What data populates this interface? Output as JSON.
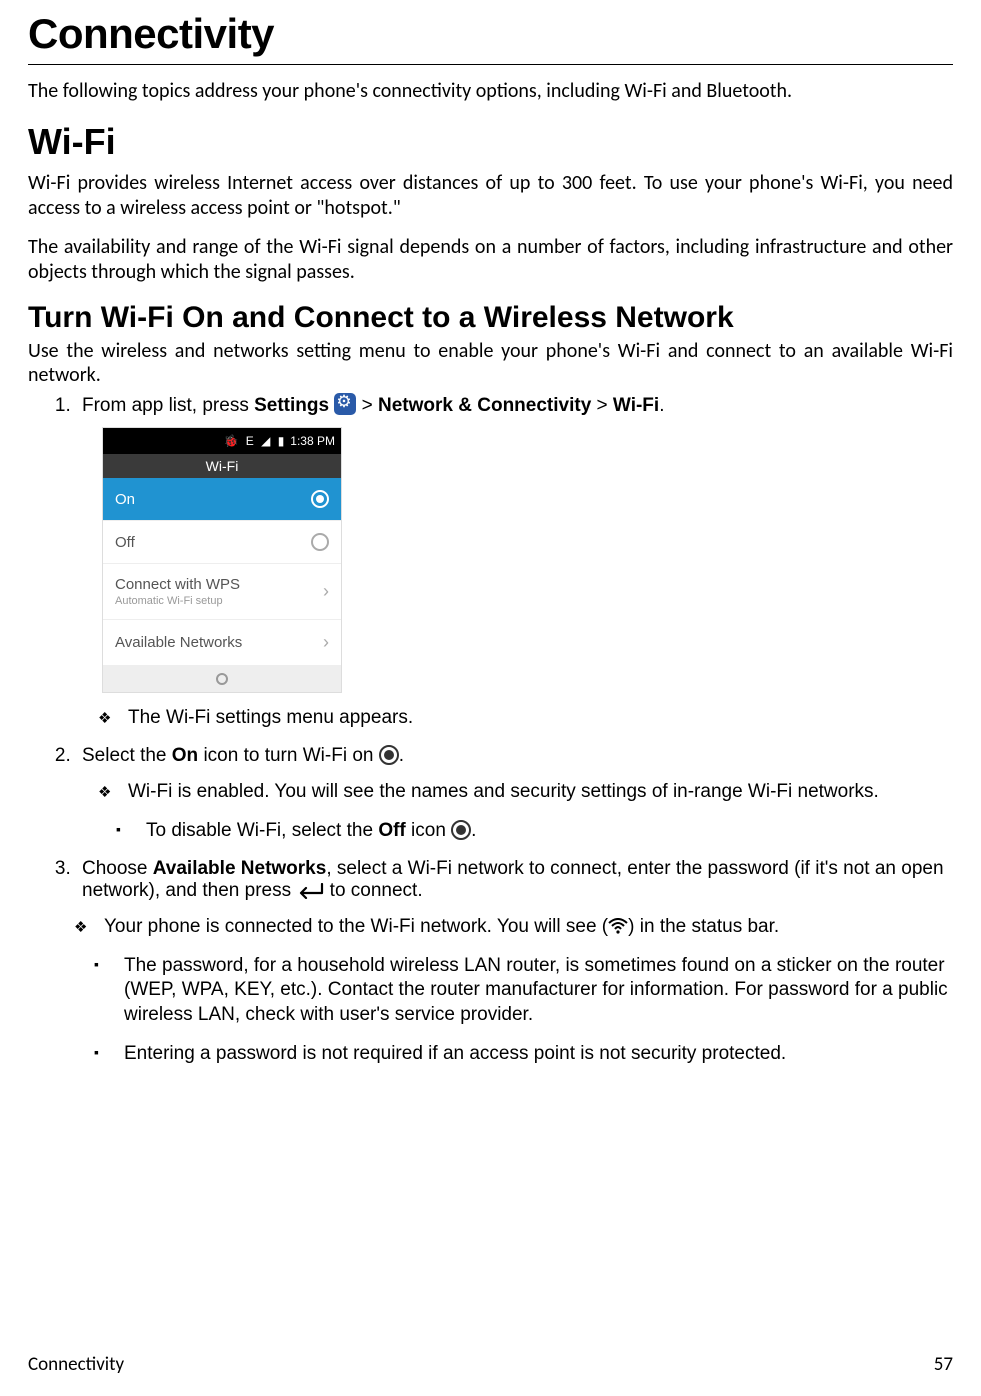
{
  "h1": "Connectivity",
  "intro": "The following topics address your phone's connectivity options, including Wi-Fi and Bluetooth.",
  "h2_wifi": "Wi-Fi",
  "wifi_p1": "Wi-Fi provides wireless Internet access over distances of up to 300 feet. To use your phone's Wi-Fi, you need access to a wireless access point or \"hotspot.\"",
  "wifi_p2": "The availability and range of the Wi-Fi signal depends on a number of factors, including infrastructure and other objects through which the signal passes.",
  "h3_turn": "Turn Wi-Fi On and Connect to a Wireless Network",
  "turn_intro": "Use the wireless and networks setting menu to enable your phone's Wi-Fi and connect to an available Wi-Fi network.",
  "step1": {
    "pre": "From app list, press ",
    "settings": "Settings",
    "mid": "  > ",
    "net": "Network & Connectivity",
    "sep": " > ",
    "wifi": "Wi-Fi",
    "end": "."
  },
  "phone": {
    "time": "1:38 PM",
    "header": "Wi-Fi",
    "on": "On",
    "off": "Off",
    "wps": "Connect with WPS",
    "wps_sub": "Automatic Wi-Fi setup",
    "avail": "Available Networks"
  },
  "dia1": "The Wi-Fi settings menu appears.",
  "step2": {
    "pre": "Select the ",
    "on": "On",
    "post": " icon to turn Wi-Fi on ",
    "end": "."
  },
  "dia2": "Wi-Fi is enabled. You will see the names and security settings of in-range Wi-Fi networks.",
  "sq1": {
    "pre": "To disable Wi-Fi, select the ",
    "off": "Off",
    "post": " icon ",
    "end": "."
  },
  "step3": {
    "pre": "Choose ",
    "avail": "Available Networks",
    "mid": ", select a Wi-Fi network to connect, enter the password (if it's not an open network), and then press ",
    "post": " to connect."
  },
  "dia3": {
    "pre": "Your phone is connected to the Wi-Fi network. You will see (",
    "post": ") in the status bar."
  },
  "sq2": "The password, for a household wireless LAN router, is sometimes found on a sticker on the router (WEP, WPA, KEY, etc.). Contact the router manufacturer for information. For password for a public wireless LAN, check with user's service provider.",
  "sq3": "Entering a password is not required if an access point is not security protected.",
  "footer_left": "Connectivity",
  "footer_right": "57"
}
